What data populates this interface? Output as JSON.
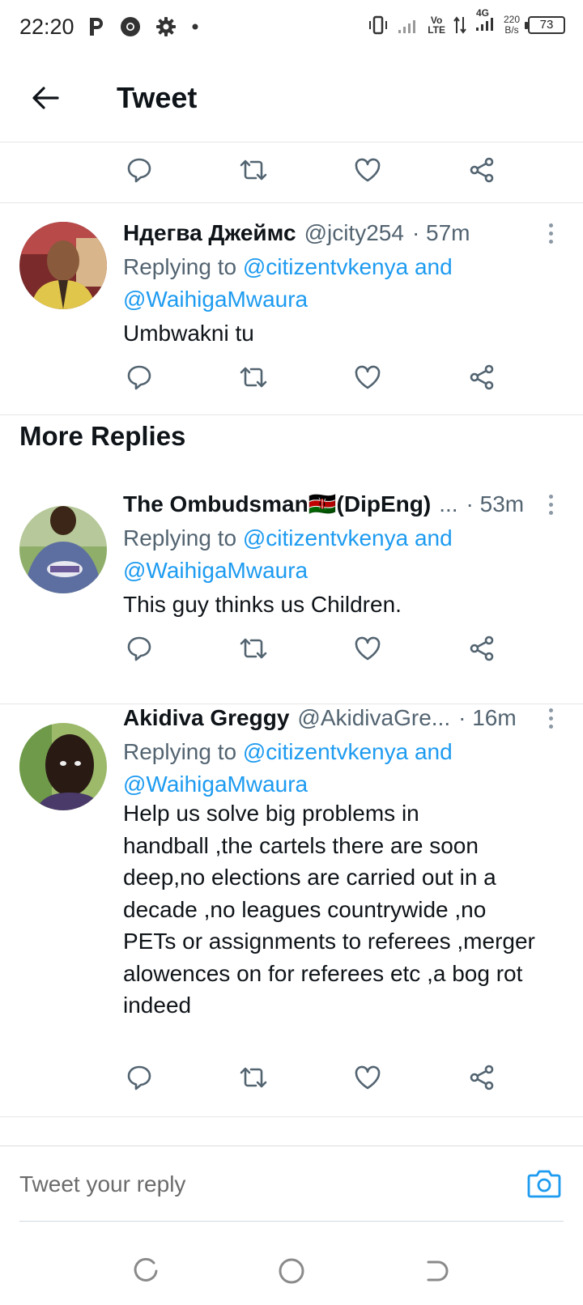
{
  "status_bar": {
    "time": "22:20",
    "left_icons": [
      "parking-icon",
      "chrome-icon",
      "settings-icon",
      "dot-icon"
    ],
    "vo_lte_top": "Vo",
    "vo_lte_bottom": "LTE",
    "network": "4G",
    "speed_value": "220",
    "speed_unit": "B/s",
    "battery": "73"
  },
  "header": {
    "title": "Tweet"
  },
  "tweets": [
    {
      "name": "Ндегва Джеймс",
      "handle": "@jcity254",
      "time": "· 57m",
      "replying_prefix": "Replying to",
      "replying_line1": "@citizentvkenya and",
      "replying_line2": "@WaihigaMwaura",
      "text_lines": [
        "Umbwakni tu"
      ]
    },
    {
      "name": "The Ombudsman🇰🇪(DipEng)",
      "handle": "...",
      "time": "· 53m",
      "replying_prefix": "Replying to",
      "replying_line1": "@citizentvkenya and",
      "replying_line2": "@WaihigaMwaura",
      "text_lines": [
        "This guy thinks us Children."
      ]
    },
    {
      "name": "Akidiva Greggy",
      "handle": "@AkidivaGre...",
      "time": "· 16m",
      "replying_prefix": "Replying to",
      "replying_line1": "@citizentvkenya and",
      "replying_line2": "@WaihigaMwaura",
      "text_lines": [
        "Help us solve big problems in",
        "handball ,the cartels there are soon",
        "deep,no elections are carried out in a",
        "decade ,no leagues countrywide ,no",
        "PETs or assignments to referees ,merger",
        "alowences on for referees etc ,a bog rot",
        "indeed"
      ]
    }
  ],
  "section": {
    "more_replies": "More Replies"
  },
  "composer": {
    "placeholder": "Tweet your reply"
  },
  "colors": {
    "link": "#1d9bf0",
    "secondary_text": "#536471",
    "icon_gray": "#536471"
  },
  "nav": [
    "recent-apps-icon",
    "home-icon",
    "back-icon"
  ]
}
